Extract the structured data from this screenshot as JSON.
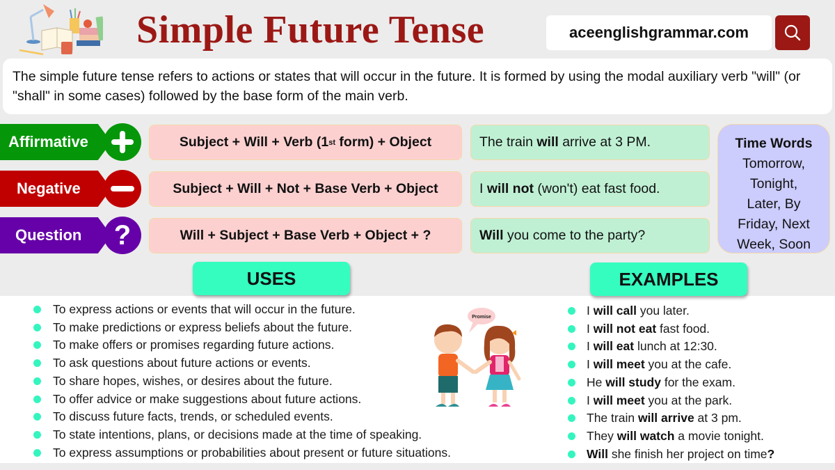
{
  "header": {
    "title": "Simple Future Tense",
    "site": "aceenglishgrammar.com",
    "search_icon": "search-icon",
    "logo_icon": "study-desk-illustration-icon"
  },
  "description": "The simple future tense refers to actions or states that will occur in the future. It is formed by using the modal auxiliary verb \"will\" (or \"shall\" in some cases) followed by the base form of the main verb.",
  "structures": [
    {
      "type": "Affirmative",
      "icon": "plus-icon",
      "color": "#06960a",
      "formula_pre": "Subject + Will + Verb (1",
      "formula_sup": "st",
      "formula_post": " form) + Object",
      "example": [
        {
          "t": "The train ",
          "b": false
        },
        {
          "t": "will",
          "b": true
        },
        {
          "t": " arrive at 3 PM.",
          "b": false
        }
      ]
    },
    {
      "type": "Negative",
      "icon": "minus-icon",
      "color": "#c00000",
      "formula": "Subject + Will + Not + Base Verb + Object",
      "example": [
        {
          "t": "I ",
          "b": false
        },
        {
          "t": "will not",
          "b": true
        },
        {
          "t": " (won't) eat fast food.",
          "b": false
        }
      ]
    },
    {
      "type": "Question",
      "icon": "question-mark-icon",
      "color": "#6600a8",
      "formula": "Will + Subject + Base Verb + Object + ?",
      "example": [
        {
          "t": "Will",
          "b": true
        },
        {
          "t": " you come to the party?",
          "b": false
        }
      ]
    }
  ],
  "time_words": {
    "title": "Time Words",
    "lines": [
      "Tomorrow,",
      "Tonight,",
      "Later, By",
      "Friday, Next",
      "Week, Soon"
    ]
  },
  "uses": {
    "heading": "USES",
    "items": [
      "To express actions or events that will occur in the future.",
      "To make predictions or express beliefs about the future.",
      "To make offers or promises regarding future actions.",
      "To ask questions about future actions or events.",
      "To share hopes, wishes, or desires about the future.",
      "To offer advice or make suggestions about future actions.",
      "To discuss future facts, trends, or scheduled events.",
      "To state intentions, plans, or decisions made at the time of speaking.",
      "To express assumptions or probabilities about present or future situations."
    ]
  },
  "examples": {
    "heading": "EXAMPLES",
    "items": [
      [
        {
          "t": "I ",
          "b": false
        },
        {
          "t": "will call",
          "b": true
        },
        {
          "t": " you later.",
          "b": false
        }
      ],
      [
        {
          "t": "I ",
          "b": false
        },
        {
          "t": "will not eat",
          "b": true
        },
        {
          "t": " fast food.",
          "b": false
        }
      ],
      [
        {
          "t": "I ",
          "b": false
        },
        {
          "t": "will eat",
          "b": true
        },
        {
          "t": " lunch at 12:30.",
          "b": false
        }
      ],
      [
        {
          "t": "I ",
          "b": false
        },
        {
          "t": "will meet",
          "b": true
        },
        {
          "t": " you at the cafe.",
          "b": false
        }
      ],
      [
        {
          "t": "He ",
          "b": false
        },
        {
          "t": "will study",
          "b": true
        },
        {
          "t": " for the exam.",
          "b": false
        }
      ],
      [
        {
          "t": "I ",
          "b": false
        },
        {
          "t": "will meet",
          "b": true
        },
        {
          "t": " you at the park.",
          "b": false
        }
      ],
      [
        {
          "t": "The train ",
          "b": false
        },
        {
          "t": "will arrive",
          "b": true
        },
        {
          "t": " at 3 pm.",
          "b": false
        }
      ],
      [
        {
          "t": "They ",
          "b": false
        },
        {
          "t": "will watch",
          "b": true
        },
        {
          "t": " a movie tonight.",
          "b": false
        }
      ],
      [
        {
          "t": "Will",
          "b": true
        },
        {
          "t": " she finish her project on time",
          "b": false
        },
        {
          "t": "?",
          "b": true
        }
      ]
    ]
  },
  "illustration": {
    "speech_bubble": "Promise",
    "icon": "kids-handshake-illustration-icon"
  },
  "colors": {
    "title": "#9b1815",
    "formula_bg": "#fdd0d0",
    "example_bg": "#bff0d4",
    "time_bg": "#ccccfd",
    "section_head": "#35fdc0",
    "bullet": "#35f5bf"
  }
}
